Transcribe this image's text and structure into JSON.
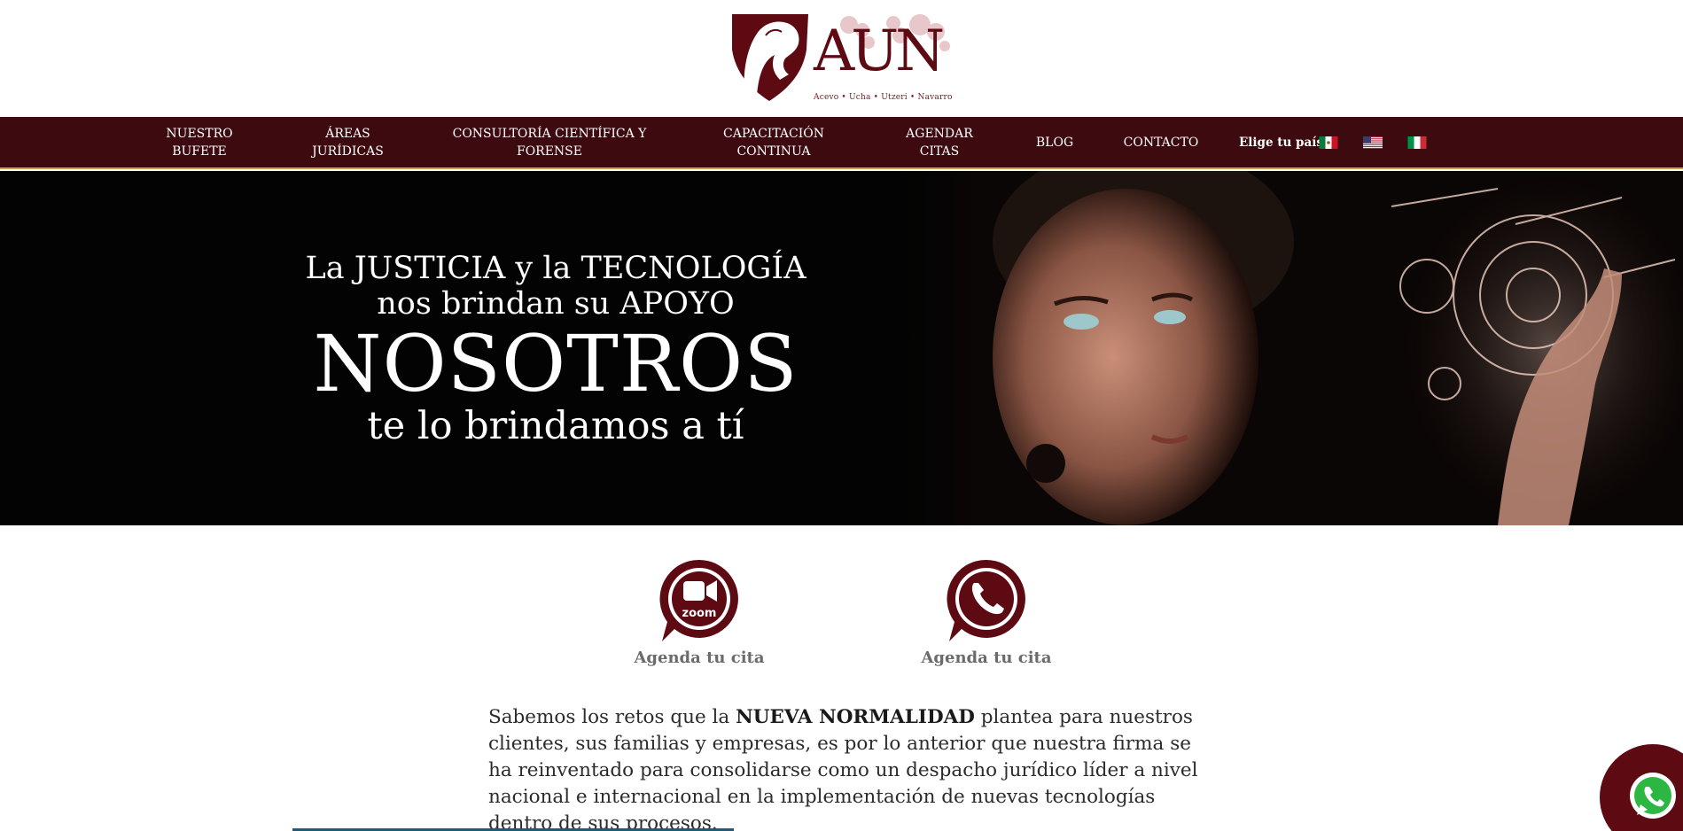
{
  "logo": {
    "wordmark": "AUN",
    "tagline": "Acevo • Ucha • Utzeri • Navarro"
  },
  "nav": {
    "items": [
      {
        "label": "NUESTRO\nBUFETE"
      },
      {
        "label": "ÁREAS\nJURÍDICAS"
      },
      {
        "label": "CONSULTORÍA CIENTÍFICA Y\nFORENSE"
      },
      {
        "label": "CAPACITACIÓN\nCONTINUA"
      },
      {
        "label": "AGENDAR\nCITAS"
      },
      {
        "label": "BLOG"
      },
      {
        "label": "CONTACTO"
      }
    ],
    "country_label": "Elige tu país:",
    "flags": [
      "mexico-flag-icon",
      "usa-flag-icon",
      "italy-flag-icon"
    ]
  },
  "hero": {
    "line1": "La JUSTICIA y la TECNOLOGÍA",
    "line2": "nos brindan su APOYO",
    "line3": "NOSOTROS",
    "line4": "te lo brindamos a tí"
  },
  "cta": {
    "zoom_label": "Agenda tu cita",
    "zoom_icon_text": "zoom",
    "whatsapp_label": "Agenda tu cita"
  },
  "intro": {
    "part1": "Sabemos los retos que la ",
    "bold": "NUEVA NORMALIDAD",
    "part2": " plantea para nuestros clientes, sus familias y empresas, es por lo anterior que nuestra firma se ha reinventado para consolidarse como un despacho jurídico líder a nivel nacional e internacional en la implementación de nuevas tecnologías dentro de sus procesos."
  },
  "colors": {
    "brand_maroon": "#5d0a12",
    "nav_bg": "#3d0a10",
    "nav_border": "#c9a14a"
  }
}
